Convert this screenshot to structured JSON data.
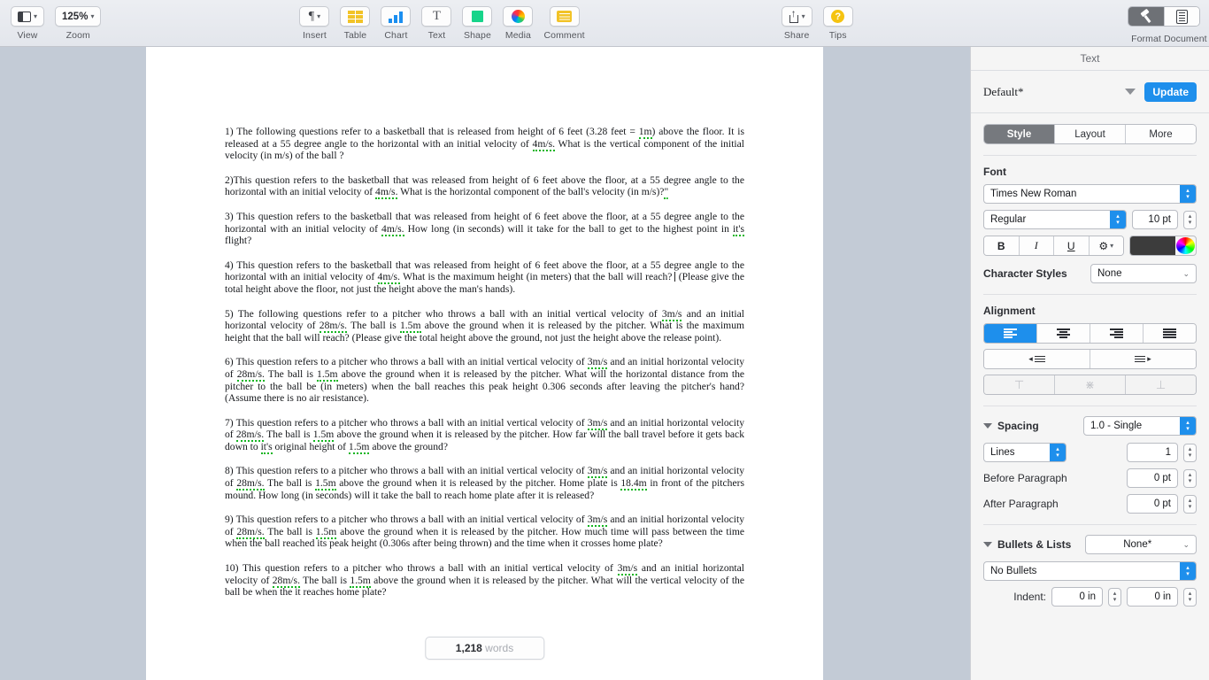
{
  "toolbar": {
    "left": [
      {
        "label": "View",
        "icon": "view-layout-icon",
        "value": ""
      },
      {
        "label": "Zoom",
        "icon": "zoom-icon",
        "value": "125%"
      }
    ],
    "center": [
      {
        "label": "Insert",
        "icon": "pilcrow-icon"
      },
      {
        "label": "Table",
        "icon": "table-icon"
      },
      {
        "label": "Chart",
        "icon": "chart-icon"
      },
      {
        "label": "Text",
        "icon": "text-icon"
      },
      {
        "label": "Shape",
        "icon": "shape-icon"
      },
      {
        "label": "Media",
        "icon": "media-icon"
      },
      {
        "label": "Comment",
        "icon": "comment-icon"
      }
    ],
    "right": [
      {
        "label": "Share",
        "icon": "share-icon"
      },
      {
        "label": "Tips",
        "icon": "tips-icon",
        "glyph": "?"
      }
    ],
    "inspector": [
      {
        "label": "Format",
        "icon": "format-brush-icon",
        "active": true
      },
      {
        "label": "Document",
        "icon": "document-icon",
        "active": false
      }
    ]
  },
  "document": {
    "word_count_number": "1,218",
    "word_count_label": "words",
    "paragraphs": [
      {
        "id": "q1",
        "parts": [
          {
            "t": "1) The following questions refer to a basketball that is released from height of 6 feet (3.28 feet = "
          },
          {
            "t": "1m",
            "spell": true
          },
          {
            "t": ") above the floor. It is released at a 55 degree angle to the horizontal with an initial velocity of "
          },
          {
            "t": "4m/s.",
            "spell": true
          },
          {
            "t": " What is the vertical component of the initial velocity (in m/s) of the ball ?"
          }
        ]
      },
      {
        "id": "q2",
        "parts": [
          {
            "t": "2)This question refers to the basketball that was released from height of 6 feet above the floor, at a 55 degree angle to the horizontal with an initial velocity of "
          },
          {
            "t": "4m/s.",
            "spell": true
          },
          {
            "t": " What is the horizontal component of the ball's velocity (in m/s)?"
          },
          {
            "t": "\"",
            "spell": true
          }
        ]
      },
      {
        "id": "q3",
        "parts": [
          {
            "t": "3) This question refers to the basketball that was released from height of 6 feet above the floor, at a 55 degree angle to the horizontal with an initial velocity of "
          },
          {
            "t": "4m/s.",
            "spell": true
          },
          {
            "t": " How long (in seconds) will it take for the ball to get to the highest point in "
          },
          {
            "t": "it's",
            "spell": true
          },
          {
            "t": " flight?"
          }
        ]
      },
      {
        "id": "q4",
        "parts": [
          {
            "t": "4) This question refers to the basketball that was released from height of 6 feet above the floor, at a 55 degree angle to the horizontal with an initial velocity of "
          },
          {
            "t": "4m/s.",
            "spell": true
          },
          {
            "t": " What is the maximum height (in meters) that the ball will reach?"
          },
          {
            "t": "",
            "caret": true
          },
          {
            "t": " (Please give the total height above the floor, not just the height above the man's hands)."
          }
        ]
      },
      {
        "id": "q5",
        "parts": [
          {
            "t": "5) The following questions refer to a pitcher who throws a ball with an initial vertical velocity of "
          },
          {
            "t": "3m/s",
            "spell": true
          },
          {
            "t": " and an initial horizontal velocity of "
          },
          {
            "t": "28m/s.",
            "spell": true
          },
          {
            "t": " The ball is "
          },
          {
            "t": "1.5m",
            "spell": true
          },
          {
            "t": " above the ground when it is released by the pitcher. What is the maximum height that the ball will reach? (Please give the total height above the ground, not just the height above the release point)."
          }
        ]
      },
      {
        "id": "q6",
        "parts": [
          {
            "t": "6) This question refers to a pitcher who throws a ball with an initial vertical velocity of "
          },
          {
            "t": "3m/s",
            "spell": true
          },
          {
            "t": " and an initial horizontal velocity of "
          },
          {
            "t": "28m/s.",
            "spell": true
          },
          {
            "t": " The ball is "
          },
          {
            "t": "1.5m",
            "spell": true
          },
          {
            "t": " above the ground when it is released by the pitcher. What will the horizontal distance from the pitcher to the ball be (in meters) when the ball reaches this peak height 0.306 seconds after leaving the pitcher's hand? (Assume there is no air resistance)."
          }
        ]
      },
      {
        "id": "q7",
        "parts": [
          {
            "t": "7) This question refers to a pitcher who throws a ball with an initial vertical velocity of "
          },
          {
            "t": "3m/s",
            "spell": true
          },
          {
            "t": " and an initial horizontal velocity of "
          },
          {
            "t": "28m/s.",
            "spell": true
          },
          {
            "t": " The ball is "
          },
          {
            "t": "1.5m",
            "spell": true
          },
          {
            "t": " above the ground when it is released by the pitcher. How far will the ball travel before it gets back down to "
          },
          {
            "t": "it's",
            "spell": true
          },
          {
            "t": " original height of "
          },
          {
            "t": "1.5m",
            "spell": true
          },
          {
            "t": " above the ground?"
          }
        ]
      },
      {
        "id": "q8",
        "parts": [
          {
            "t": "8) This question refers to a pitcher who throws a ball with an initial vertical velocity of "
          },
          {
            "t": "3m/s",
            "spell": true
          },
          {
            "t": " and an initial horizontal velocity of "
          },
          {
            "t": "28m/s.",
            "spell": true
          },
          {
            "t": " The ball is "
          },
          {
            "t": "1.5m",
            "spell": true
          },
          {
            "t": " above the ground when it is released by the pitcher. Home plate is "
          },
          {
            "t": "18.4m",
            "spell": true
          },
          {
            "t": " in front of the pitchers mound. How long (in seconds) will it take the ball to reach home plate after it is released?"
          }
        ]
      },
      {
        "id": "q9",
        "parts": [
          {
            "t": "9) This question refers to a pitcher who throws a ball with an initial vertical velocity of "
          },
          {
            "t": "3m/s",
            "spell": true
          },
          {
            "t": " and an initial horizontal velocity of "
          },
          {
            "t": "28m/s.",
            "spell": true
          },
          {
            "t": " The ball is "
          },
          {
            "t": "1.5m",
            "spell": true
          },
          {
            "t": " above the ground when it is released by the pitcher. How much time will pass between the time when the ball reached its peak height (0.306s after being thrown) and the time when it crosses home plate?"
          }
        ]
      },
      {
        "id": "q10",
        "parts": [
          {
            "t": "10) This question refers to a pitcher who throws a ball with an initial vertical velocity of "
          },
          {
            "t": "3m/s",
            "spell": true
          },
          {
            "t": " and an initial horizontal velocity of "
          },
          {
            "t": "28m/s.",
            "spell": true
          },
          {
            "t": " The ball is "
          },
          {
            "t": "1.5m",
            "spell": true
          },
          {
            "t": " above the ground when it is released by the pitcher. What will the vertical velocity of the ball be when the it reaches home plate?"
          }
        ]
      }
    ]
  },
  "panel": {
    "title": "Text",
    "style_name": "Default*",
    "update_label": "Update",
    "tabs": [
      {
        "label": "Style",
        "active": true
      },
      {
        "label": "Layout",
        "active": false
      },
      {
        "label": "More",
        "active": false
      }
    ],
    "font": {
      "section_label": "Font",
      "family": "Times New Roman",
      "weight": "Regular",
      "size": "10 pt",
      "bold_label": "B",
      "italic_label": "I",
      "underline_label": "U",
      "color_hex": "#3c3c3c",
      "character_styles_label": "Character Styles",
      "character_styles_value": "None"
    },
    "alignment": {
      "section_label": "Alignment",
      "buttons": [
        {
          "name": "align-left",
          "active": true
        },
        {
          "name": "align-center",
          "active": false
        },
        {
          "name": "align-right",
          "active": false
        },
        {
          "name": "align-justify",
          "active": false
        }
      ],
      "indent_decrease": "decrease-indent",
      "indent_increase": "increase-indent",
      "vertical": [
        {
          "name": "align-top",
          "glyph": "⊤",
          "disabled": true
        },
        {
          "name": "align-middle",
          "glyph": "⋇",
          "disabled": true
        },
        {
          "name": "align-bottom",
          "glyph": "⊥",
          "disabled": true
        }
      ]
    },
    "spacing": {
      "section_label": "Spacing",
      "mode": "1.0 - Single",
      "unit": "Lines",
      "unit_value": "1",
      "before_label": "Before Paragraph",
      "before_value": "0 pt",
      "after_label": "After Paragraph",
      "after_value": "0 pt"
    },
    "bullets": {
      "section_label": "Bullets & Lists",
      "preset": "None*",
      "type": "No Bullets",
      "indent_label": "Indent:",
      "indent_left": "0 in",
      "indent_right": "0 in"
    }
  }
}
